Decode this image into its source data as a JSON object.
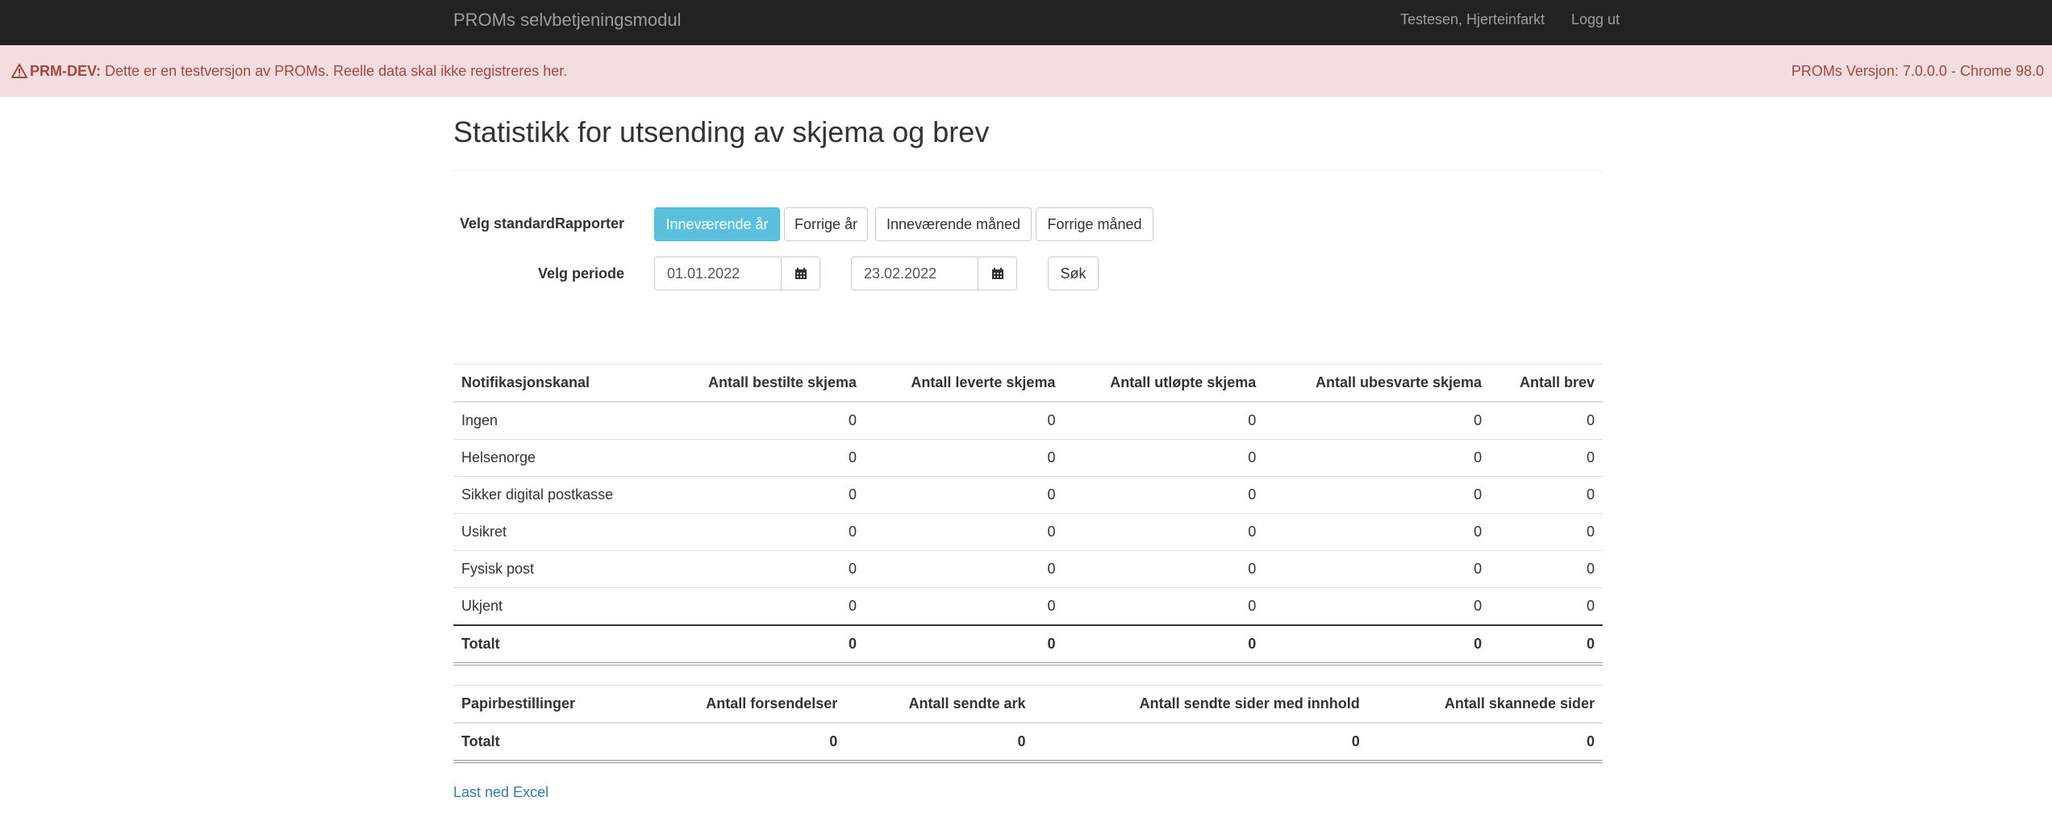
{
  "navbar": {
    "brand": "PROMs selvbetjeningsmodul",
    "user": "Testesen, Hjerteinfarkt",
    "logout": "Logg ut"
  },
  "alert": {
    "prefix": "PRM-DEV:",
    "message": "Dette er en testversjon av PROMs. Reelle data skal ikke registreres her.",
    "version": "PROMs Versjon: 7.0.0.0 - Chrome 98.0",
    "icon": "warning-triangle-icon"
  },
  "page": {
    "title": "Statistikk for utsending av skjema og brev"
  },
  "filters": {
    "standard_label": "Velg standardRapporter",
    "buttons": [
      "Inneværende år",
      "Forrige år",
      "Inneværende måned",
      "Forrige måned"
    ],
    "active_button": "Inneværende år",
    "period_label": "Velg periode",
    "date_from": "01.01.2022",
    "date_to": "23.02.2022",
    "search_label": "Søk"
  },
  "notification_table": {
    "headers": [
      "Notifikasjonskanal",
      "Antall bestilte skjema",
      "Antall leverte skjema",
      "Antall utløpte skjema",
      "Antall ubesvarte skjema",
      "Antall brev"
    ],
    "rows": [
      [
        "Ingen",
        "0",
        "0",
        "0",
        "0",
        "0"
      ],
      [
        "Helsenorge",
        "0",
        "0",
        "0",
        "0",
        "0"
      ],
      [
        "Sikker digital postkasse",
        "0",
        "0",
        "0",
        "0",
        "0"
      ],
      [
        "Usikret",
        "0",
        "0",
        "0",
        "0",
        "0"
      ],
      [
        "Fysisk post",
        "0",
        "0",
        "0",
        "0",
        "0"
      ],
      [
        "Ukjent",
        "0",
        "0",
        "0",
        "0",
        "0"
      ]
    ],
    "total": [
      "Totalt",
      "0",
      "0",
      "0",
      "0",
      "0"
    ]
  },
  "paper_table": {
    "headers": [
      "Papirbestillinger",
      "Antall forsendelser",
      "Antall sendte ark",
      "Antall sendte sider med innhold",
      "Antall skannede sider"
    ],
    "total": [
      "Totalt",
      "0",
      "0",
      "0",
      "0"
    ]
  },
  "footer": {
    "excel_link": "Last ned Excel"
  },
  "colors": {
    "navbar_bg": "#222222",
    "alert_bg": "#f2dede",
    "alert_text": "#a94442",
    "active_button": "#5bc0de",
    "link": "#337ab7"
  }
}
